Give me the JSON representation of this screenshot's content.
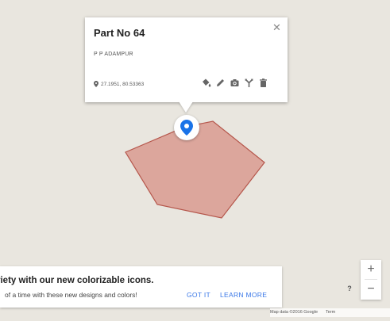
{
  "map": {
    "background_color": "#e9e6df",
    "polygon_fill": "#d99a90",
    "polygon_stroke": "#b5564b"
  },
  "info_window": {
    "title": "Part No 64",
    "subtitle": "P P ADAMPUR",
    "coordinates": "27.1951, 80.53363",
    "coords_icon": "location-pin-icon",
    "close_icon": "close-icon",
    "actions": [
      "paint-bucket-icon",
      "pencil-icon",
      "camera-icon",
      "directions-icon",
      "trash-icon"
    ]
  },
  "marker": {
    "icon": "blue-map-pin-icon",
    "color": "#1a73e8"
  },
  "promo": {
    "title": "riety with our new colorizable icons.",
    "body": "of a time with these new designs and colors!",
    "got_it": "GOT IT",
    "learn_more": "LEARN MORE",
    "accent": "#3b78e7"
  },
  "controls": {
    "zoom_in": "+",
    "zoom_out": "−",
    "help": "?"
  },
  "attribution": {
    "text": "Map data ©2016 Google",
    "terms": "Term"
  }
}
